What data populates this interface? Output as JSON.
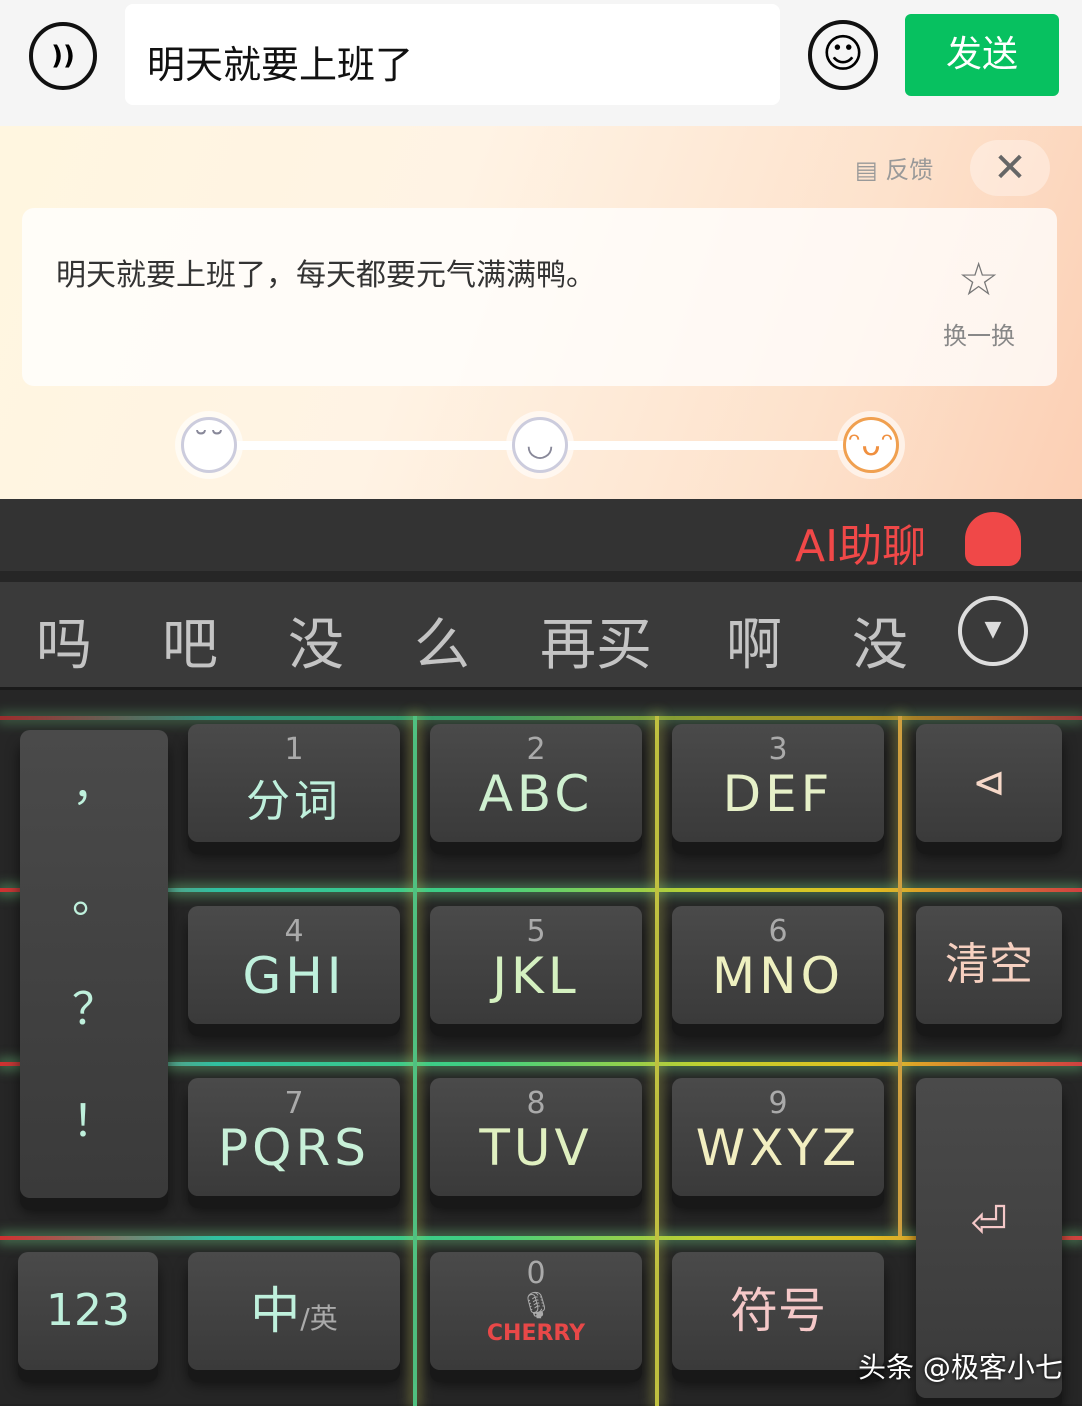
{
  "top": {
    "voice_icon": "voice-icon",
    "input_value": "明天就要上班了",
    "emoji_icon": "emoji-icon",
    "send_label": "发送",
    "send_color": "#07c160"
  },
  "ai_panel": {
    "feedback_label": "反馈",
    "close_icon": "close-icon",
    "suggestion": "明天就要上班了，每天都要元气满满鸭。",
    "swap_label": "换一换",
    "swap_icon": "magic-wand-icon",
    "mood_faces": [
      "sad-face-icon",
      "smile-face-icon",
      "laugh-face-icon"
    ],
    "selected_mood": 2
  },
  "keyboard": {
    "ai_label": "AI助聊",
    "ai_color": "#f04848",
    "candidates": [
      "吗",
      "吧",
      "没",
      "么",
      "再买",
      "啊",
      "没有"
    ],
    "candidates_visible": [
      "吗",
      "吧",
      "没",
      "么",
      "再买",
      "啊",
      "没"
    ],
    "punct": [
      "，",
      "。",
      "？",
      "！"
    ],
    "keys": [
      {
        "num": "1",
        "label": "分词"
      },
      {
        "num": "2",
        "label": "ABC"
      },
      {
        "num": "3",
        "label": "DEF"
      },
      {
        "num": "4",
        "label": "GHI"
      },
      {
        "num": "5",
        "label": "JKL"
      },
      {
        "num": "6",
        "label": "MNO"
      },
      {
        "num": "7",
        "label": "PQRS"
      },
      {
        "num": "8",
        "label": "TUV"
      },
      {
        "num": "9",
        "label": "WXYZ"
      }
    ],
    "backspace_icon": "backspace-icon",
    "clear_label": "清空",
    "enter_icon": "enter-icon",
    "num_label": "123",
    "lang_main": "中",
    "lang_alt": "/英",
    "zero_num": "0",
    "brand": "CHERRY",
    "symbol_label": "符号"
  },
  "watermark": "头条 @极客小七"
}
